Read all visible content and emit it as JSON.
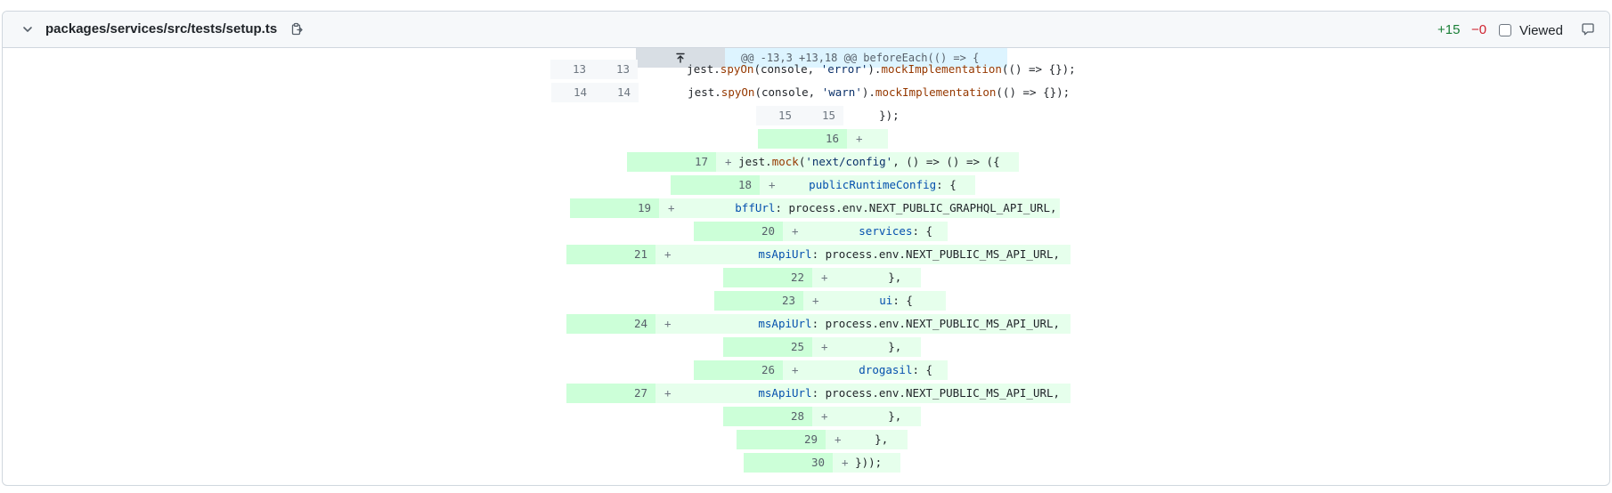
{
  "file": {
    "name": "packages/services/src/tests/setup.ts",
    "additions": "+15",
    "deletions": "−0",
    "viewed_label": "Viewed",
    "icons": {
      "collapse": "chevron-down-icon",
      "copy": "copy-icon",
      "comment": "comment-icon"
    }
  },
  "hunk": {
    "header": "@@ -13,3 +13,18 @@ beforeEach(() => {",
    "expand_icon": "expand-up-icon"
  },
  "lines": [
    {
      "old": "13",
      "new": "13",
      "sign": " ",
      "parts": [
        [
          "",
          "    jest."
        ],
        [
          "fn2",
          "spyOn"
        ],
        [
          "",
          "(console, "
        ],
        [
          "str",
          "'error'"
        ],
        [
          "",
          ")."
        ],
        [
          "fn2",
          "mockImplementation"
        ],
        [
          "",
          "(() => {});"
        ]
      ]
    },
    {
      "old": "14",
      "new": "14",
      "sign": " ",
      "parts": [
        [
          "",
          "    jest."
        ],
        [
          "fn2",
          "spyOn"
        ],
        [
          "",
          "(console, "
        ],
        [
          "str",
          "'warn'"
        ],
        [
          "",
          ")."
        ],
        [
          "fn2",
          "mockImplementation"
        ],
        [
          "",
          "(() => {});"
        ]
      ]
    },
    {
      "old": "15",
      "new": "15",
      "sign": " ",
      "parts": [
        [
          "",
          "  });"
        ]
      ]
    },
    {
      "old": "",
      "new": "16",
      "sign": "+",
      "parts": [
        [
          "",
          ""
        ]
      ]
    },
    {
      "old": "",
      "new": "17",
      "sign": "+",
      "parts": [
        [
          "",
          "jest."
        ],
        [
          "fn2",
          "mock"
        ],
        [
          "",
          "("
        ],
        [
          "str",
          "'next/config'"
        ],
        [
          "",
          ", () => () => ({"
        ]
      ]
    },
    {
      "old": "",
      "new": "18",
      "sign": "+",
      "parts": [
        [
          "",
          "    "
        ],
        [
          "prop",
          "publicRuntimeConfig"
        ],
        [
          "",
          ": {"
        ]
      ]
    },
    {
      "old": "",
      "new": "19",
      "sign": "+",
      "parts": [
        [
          "",
          "        "
        ],
        [
          "prop",
          "bffUrl"
        ],
        [
          "",
          ": process.env.NEXT_PUBLIC_GRAPHQL_API_URL,"
        ]
      ]
    },
    {
      "old": "",
      "new": "20",
      "sign": "+",
      "parts": [
        [
          "",
          "        "
        ],
        [
          "prop",
          "services"
        ],
        [
          "",
          ": {"
        ]
      ]
    },
    {
      "old": "",
      "new": "21",
      "sign": "+",
      "parts": [
        [
          "",
          "            "
        ],
        [
          "prop",
          "msApiUrl"
        ],
        [
          "",
          ": process.env.NEXT_PUBLIC_MS_API_URL,"
        ]
      ]
    },
    {
      "old": "",
      "new": "22",
      "sign": "+",
      "parts": [
        [
          "",
          "        },"
        ]
      ]
    },
    {
      "old": "",
      "new": "23",
      "sign": "+",
      "parts": [
        [
          "",
          "        "
        ],
        [
          "prop",
          "ui"
        ],
        [
          "",
          ": {"
        ]
      ]
    },
    {
      "old": "",
      "new": "24",
      "sign": "+",
      "parts": [
        [
          "",
          "            "
        ],
        [
          "prop",
          "msApiUrl"
        ],
        [
          "",
          ": process.env.NEXT_PUBLIC_MS_API_URL,"
        ]
      ]
    },
    {
      "old": "",
      "new": "25",
      "sign": "+",
      "parts": [
        [
          "",
          "        },"
        ]
      ]
    },
    {
      "old": "",
      "new": "26",
      "sign": "+",
      "parts": [
        [
          "",
          "        "
        ],
        [
          "prop",
          "drogasil"
        ],
        [
          "",
          ": {"
        ]
      ]
    },
    {
      "old": "",
      "new": "27",
      "sign": "+",
      "parts": [
        [
          "",
          "            "
        ],
        [
          "prop",
          "msApiUrl"
        ],
        [
          "",
          ": process.env.NEXT_PUBLIC_MS_API_URL,"
        ]
      ]
    },
    {
      "old": "",
      "new": "28",
      "sign": "+",
      "parts": [
        [
          "",
          "        },"
        ]
      ]
    },
    {
      "old": "",
      "new": "29",
      "sign": "+",
      "parts": [
        [
          "",
          "    },"
        ]
      ]
    },
    {
      "old": "",
      "new": "30",
      "sign": "+",
      "parts": [
        [
          "",
          "}));"
        ]
      ]
    }
  ]
}
